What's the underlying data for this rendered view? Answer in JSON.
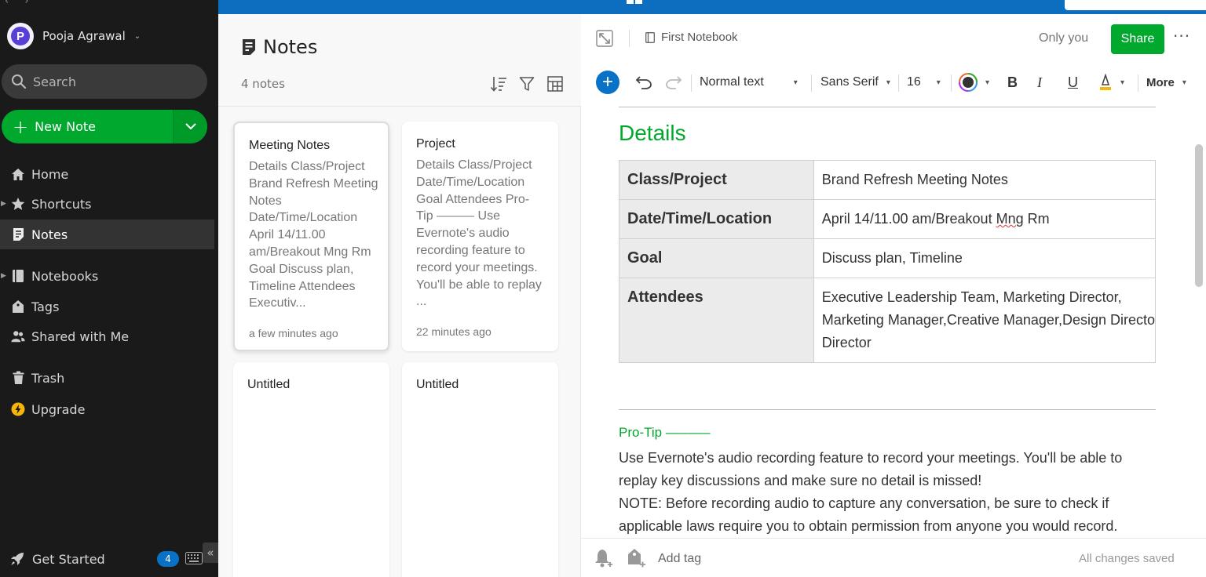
{
  "colors": {
    "brand_green": "#00a82d",
    "sidebar_bg": "#1a1a1a",
    "banner_blue": "#0d6ec0",
    "accent_blue": "#0a72c6"
  },
  "sidebar": {
    "user_name": "Pooja Agrawal",
    "avatar_letter": "P",
    "search_label": "Search",
    "new_note_label": "New Note",
    "nav": [
      {
        "label": "Home",
        "icon": "home-icon"
      },
      {
        "label": "Shortcuts",
        "icon": "star-icon"
      },
      {
        "label": "Notes",
        "icon": "notes-icon",
        "active": true
      },
      {
        "label": "Notebooks",
        "icon": "notebook-icon"
      },
      {
        "label": "Tags",
        "icon": "tag-icon"
      },
      {
        "label": "Shared with Me",
        "icon": "people-icon"
      },
      {
        "label": "Trash",
        "icon": "trash-icon"
      },
      {
        "label": "Upgrade",
        "icon": "upgrade-icon"
      }
    ],
    "get_started_label": "Get Started",
    "get_started_badge": "4"
  },
  "note_list": {
    "title": "Notes",
    "count": "4 notes",
    "cards": [
      {
        "title": "Meeting Notes",
        "snippet": "Details Class/Project Brand Refresh Meeting Notes Date/Time/Location April 14/11.00 am/Breakout Mng Rm Goal Discuss plan, Timeline Attendees Executiv...",
        "time": "a few minutes ago"
      },
      {
        "title": "Project",
        "snippet": "Details Class/Project Date/Time/Location Goal Attendees Pro-Tip ——— Use Evernote's audio recording feature to record your meetings. You'll be able to replay ...",
        "time": "22 minutes ago"
      },
      {
        "title": "Untitled",
        "snippet": "",
        "time": ""
      },
      {
        "title": "Untitled",
        "snippet": "",
        "time": ""
      }
    ]
  },
  "editor": {
    "notebook": "First Notebook",
    "visibility": "Only you",
    "share_label": "Share",
    "toolbar": {
      "style": "Normal text",
      "font": "Sans Serif",
      "size": "16",
      "more": "More"
    },
    "heading": "Details",
    "table": [
      {
        "key": "Class/Project",
        "value": "Brand Refresh Meeting Notes"
      },
      {
        "key": "Date/Time/Location",
        "value_pre": "April 14/11.00 am/Breakout ",
        "value_spell": "Mng",
        "value_post": " Rm"
      },
      {
        "key": "Goal",
        "value": "Discuss plan, Timeline"
      },
      {
        "key": "Attendees",
        "value_lines": [
          "Executive Leadership Team, Marketing Director,",
          "Marketing Manager,Creative Manager,Design Directo",
          "Director"
        ]
      }
    ],
    "protip": "Pro-Tip ––––––",
    "para1": "Use Evernote's audio recording feature to record your meetings. You'll be able to replay key discussions and make sure no detail is missed!",
    "para2": "NOTE: Before recording audio to capture any conversation, be sure to check if applicable laws require you to obtain permission from anyone you would record.",
    "add_tag": "Add tag",
    "save_status": "All changes saved"
  }
}
